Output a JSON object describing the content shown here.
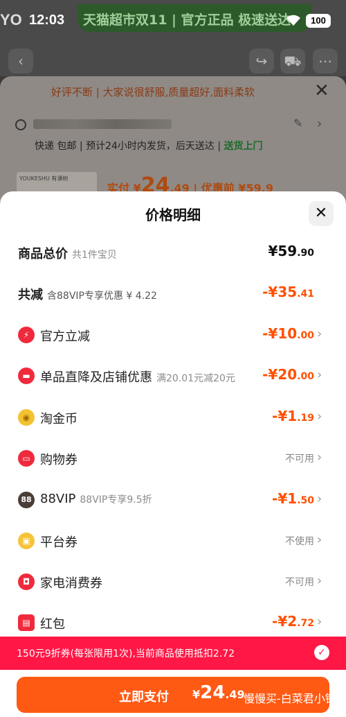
{
  "status_bar": {
    "time": "12:03",
    "battery": "100",
    "app_letters": "YO"
  },
  "banner": {
    "text": "天猫超市双11 | 官方正品 极速送达"
  },
  "order": {
    "tip": "好评不断 | 大家说很舒服,质量超好,面料柔软",
    "shipping_a": "快递 包邮 | 预计24小时内发货，后天送达 | ",
    "shipping_b": "送货上门",
    "product_brand": "YOUKESHU 有课树",
    "pay_prefix": "实付 ¥",
    "pay_int": "24",
    "pay_dec": ".49",
    "before_price": " | 优惠前 ¥59.9"
  },
  "sheet": {
    "title": "价格明细",
    "rows": [
      {
        "label": "商品总价",
        "sub": "共1件宝贝",
        "value": "¥59",
        "dec": ".90"
      },
      {
        "label": "共减",
        "sub": "含88VIP专享优惠 ¥ 4.22",
        "value": "-¥35",
        "dec": ".41"
      },
      {
        "label": "官方立减",
        "sub": "",
        "value": "-¥10",
        "dec": ".00"
      },
      {
        "label": "单品直降及店铺优惠",
        "sub": "满20.01元减20元",
        "value": "-¥20",
        "dec": ".00"
      },
      {
        "label": "淘金币",
        "sub": "",
        "value": "-¥1",
        "dec": ".19"
      },
      {
        "label": "购物券",
        "sub": "",
        "value": "不可用",
        "dec": ""
      },
      {
        "label": "88VIP",
        "sub": "88VIP专享9.5折",
        "value": "-¥1",
        "dec": ".50"
      },
      {
        "label": "平台券",
        "sub": "",
        "value": "不使用",
        "dec": ""
      },
      {
        "label": "家电消费券",
        "sub": "",
        "value": "不可用",
        "dec": ""
      },
      {
        "label": "红包",
        "sub": "",
        "value": "-¥2",
        "dec": ".72"
      }
    ],
    "icon_88": "88"
  },
  "coupon_bar": {
    "text": "150元9折券(每张限用1次),当前商品使用抵扣2.72"
  },
  "pay_button": {
    "label": "立即支付",
    "symbol": "¥",
    "amount_int": "24",
    "amount_dec": ".49",
    "watermark": "慢慢买-白菜君小锅"
  },
  "colors": {
    "accent": "#ff5000",
    "coupon_bar": "#ff1746",
    "pay_button": "#ff5a14"
  },
  "icons": [
    "back-icon",
    "share-icon",
    "cart-icon",
    "more-icon",
    "close-icon",
    "location-icon",
    "edit-icon",
    "lightning-icon",
    "shop-discount-icon",
    "gold-coin-icon",
    "ticket-icon",
    "vip-88-icon",
    "gift-icon",
    "appliance-coupon-icon",
    "red-packet-icon",
    "check-icon"
  ]
}
